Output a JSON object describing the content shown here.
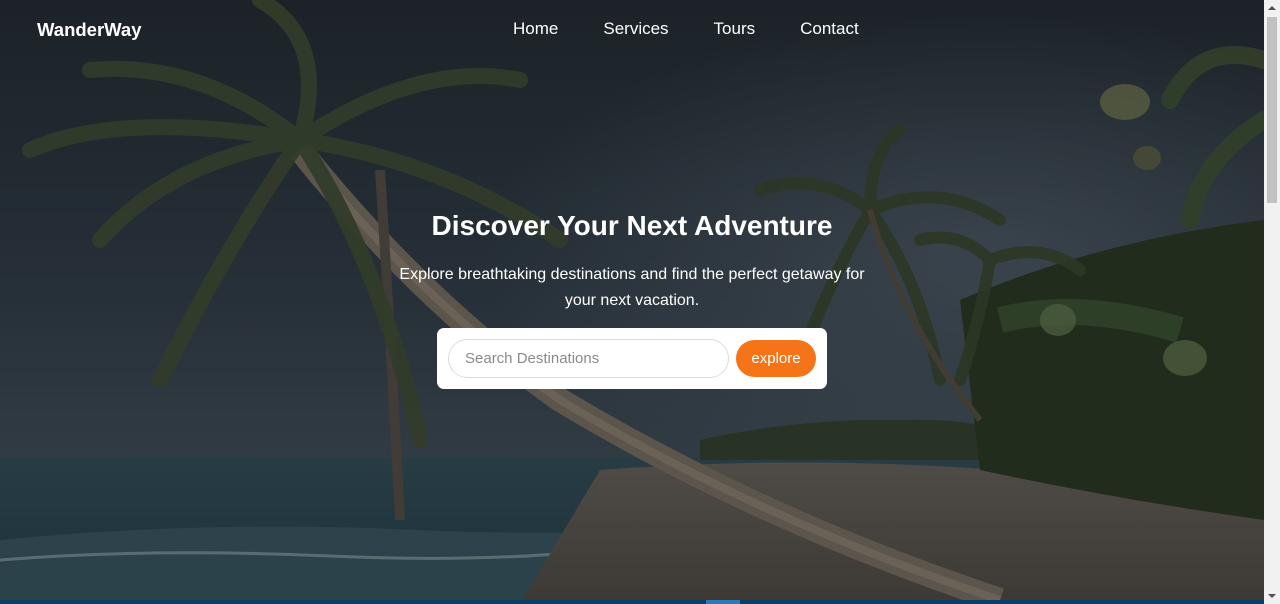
{
  "brand": "WanderWay",
  "nav": {
    "items": [
      {
        "label": "Home"
      },
      {
        "label": "Services"
      },
      {
        "label": "Tours"
      },
      {
        "label": "Contact"
      }
    ]
  },
  "hero": {
    "title": "Discover Your Next Adventure",
    "subtitle": "Explore breathtaking destinations and find the perfect getaway for your next vacation."
  },
  "search": {
    "placeholder": "Search Destinations",
    "value": "",
    "button_label": "explore"
  },
  "colors": {
    "accent": "#f57418",
    "text": "#ffffff",
    "search_bg": "#ffffff"
  },
  "icons": {
    "scroll_up": "chevron-up-icon",
    "scroll_down": "chevron-down-icon"
  }
}
